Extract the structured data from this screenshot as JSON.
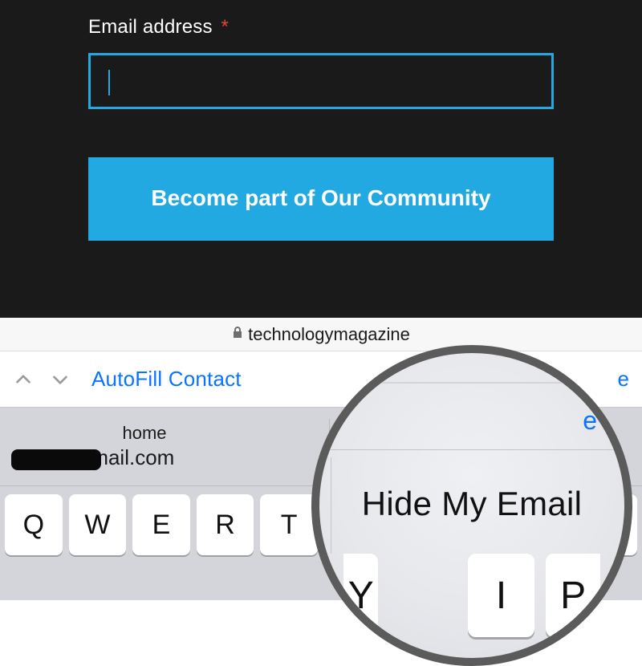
{
  "form": {
    "email_label": "Email address",
    "required_mark": "*",
    "submit_label": "Become part of Our Community"
  },
  "address_bar": {
    "domain": "technologymagazine"
  },
  "autofill_bar": {
    "label": "AutoFill Contact",
    "done": "e"
  },
  "suggestion": {
    "label": "home",
    "email_suffix": "u@gmail.com",
    "hide_label": "Hide My Email"
  },
  "keyboard": {
    "keys": [
      "Q",
      "W",
      "E",
      "R",
      "T",
      "Y",
      "",
      "",
      "",
      "P"
    ]
  },
  "magnifier": {
    "done_fragment": "e",
    "text": "Hide My Email",
    "keys_left": "Y",
    "keys_mid": "I",
    "keys_right": "P"
  }
}
